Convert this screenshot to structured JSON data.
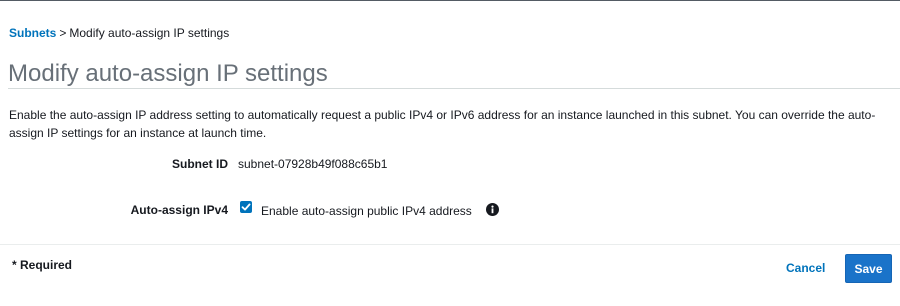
{
  "breadcrumb": {
    "parent": "Subnets",
    "separator": ">",
    "current": "Modify auto-assign IP settings"
  },
  "page": {
    "title": "Modify auto-assign IP settings",
    "description": "Enable the auto-assign IP address setting to automatically request a public IPv4 or IPv6 address for an instance launched in this subnet. You can override the auto-assign IP settings for an instance at launch time."
  },
  "form": {
    "subnet_id_label": "Subnet ID",
    "subnet_id_value": "subnet-07928b49f088c65b1",
    "auto_assign_label": "Auto-assign IPv4",
    "auto_assign_checkbox_label": "Enable auto-assign public IPv4 address",
    "auto_assign_checked": true
  },
  "footer": {
    "required_note": "* Required",
    "cancel_label": "Cancel",
    "save_label": "Save"
  },
  "colors": {
    "link": "#0073bb",
    "primary_button": "#1a73c9",
    "title_text": "#687078"
  },
  "icons": {
    "checkbox": "checkmark-icon",
    "info": "info-icon"
  }
}
